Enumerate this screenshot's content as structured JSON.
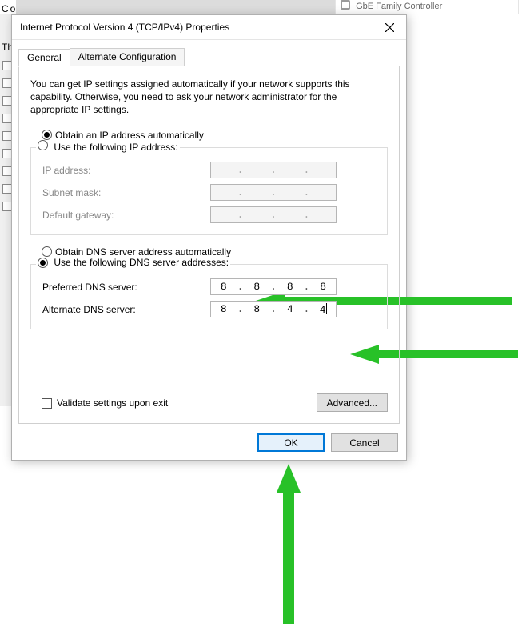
{
  "bg": {
    "top_right_text": "GbE Family Controller",
    "co_text": "Co",
    "th_text": "Th"
  },
  "dialog": {
    "title": "Internet Protocol Version 4 (TCP/IPv4) Properties",
    "tabs": {
      "general": "General",
      "alternate": "Alternate Configuration"
    },
    "description": "You can get IP settings assigned automatically if your network supports this capability. Otherwise, you need to ask your network administrator for the appropriate IP settings.",
    "ip_section": {
      "radio_auto": "Obtain an IP address automatically",
      "radio_manual": "Use the following IP address:",
      "ip_address_label": "IP address:",
      "subnet_label": "Subnet mask:",
      "gateway_label": "Default gateway:",
      "ip_address": [
        "",
        "",
        "",
        ""
      ],
      "subnet": [
        "",
        "",
        "",
        ""
      ],
      "gateway": [
        "",
        "",
        "",
        ""
      ],
      "selected": "auto"
    },
    "dns_section": {
      "radio_auto": "Obtain DNS server address automatically",
      "radio_manual": "Use the following DNS server addresses:",
      "preferred_label": "Preferred DNS server:",
      "alternate_label": "Alternate DNS server:",
      "preferred": [
        "8",
        "8",
        "8",
        "8"
      ],
      "alternate": [
        "8",
        "8",
        "4",
        "4"
      ],
      "selected": "manual"
    },
    "validate_label": "Validate settings upon exit",
    "validate_checked": false,
    "advanced_label": "Advanced...",
    "ok_label": "OK",
    "cancel_label": "Cancel"
  }
}
